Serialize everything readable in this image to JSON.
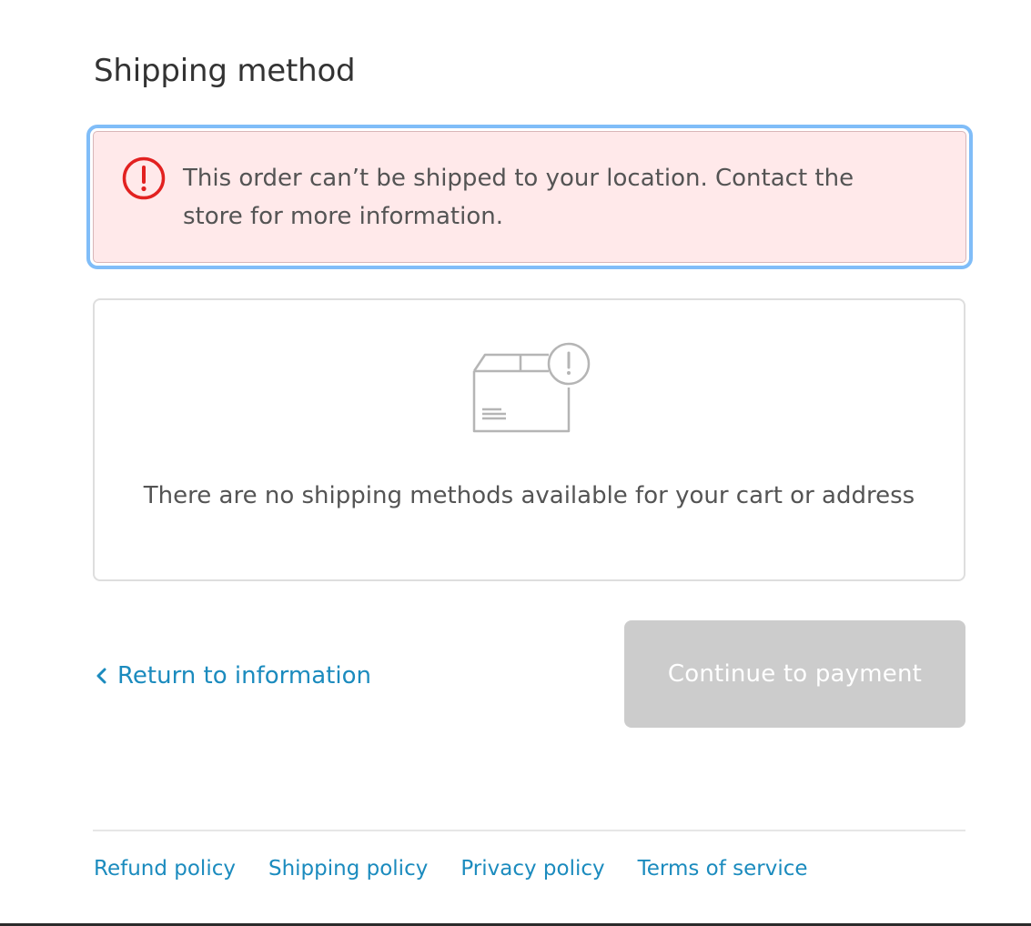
{
  "section": {
    "title": "Shipping method"
  },
  "alert": {
    "icon": "error-circle-icon",
    "message": "This order can’t be shipped to your location. Contact the store for more information.",
    "background": "#ffe9ea",
    "icon_color": "#e22120",
    "focus_ring": "#80bdf8"
  },
  "empty_state": {
    "icon": "package-warning-icon",
    "message": "There are no shipping methods available for your cart or address"
  },
  "actions": {
    "return_label": "Return to information",
    "return_icon": "chevron-left-icon",
    "continue_label": "Continue to payment",
    "continue_disabled": true
  },
  "footer": {
    "links": [
      {
        "label": "Refund policy"
      },
      {
        "label": "Shipping policy"
      },
      {
        "label": "Privacy policy"
      },
      {
        "label": "Terms of service"
      }
    ]
  },
  "colors": {
    "link": "#1b8bbe",
    "disabled_button": "#cccccc"
  }
}
